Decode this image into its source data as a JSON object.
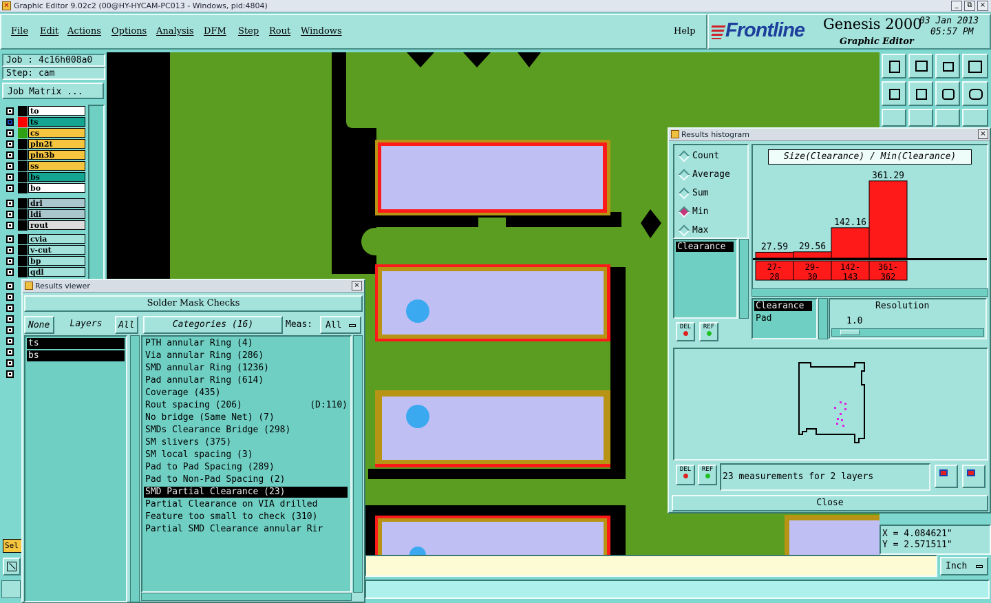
{
  "window": {
    "title": "Graphic Editor 9.02c2 (00@HY-HYCAM-PC013 - Windows, pid:4804)",
    "min": "_",
    "max": "⧉",
    "close": "×"
  },
  "menubar": {
    "items": [
      "File",
      "Edit",
      "Actions",
      "Options",
      "Analysis",
      "DFM",
      "Step",
      "Rout",
      "Windows"
    ],
    "help": "Help"
  },
  "brand": {
    "logo": "Frontline",
    "product": "Genesis 2000",
    "subtitle": "Graphic Editor",
    "date": "03 Jan 2013",
    "time": "05:57 PM"
  },
  "job": {
    "job": "Job : 4c16h008a0",
    "step": "Step: cam",
    "matrix_button": "Job Matrix ..."
  },
  "layers": {
    "group1": [
      {
        "name": "to",
        "color": "#ffffff",
        "swatch": "#000000"
      },
      {
        "name": "ts",
        "color": "#13a592",
        "swatch": "#ff0000",
        "active": true
      },
      {
        "name": "cs",
        "color": "#f6c540",
        "swatch": "#2fa014"
      },
      {
        "name": "pln2t",
        "color": "#f6c540",
        "swatch": "#000000"
      },
      {
        "name": "pln3b",
        "color": "#f6c540",
        "swatch": "#000000"
      },
      {
        "name": "ss",
        "color": "#f6c540",
        "swatch": "#000000"
      },
      {
        "name": "bs",
        "color": "#13a592",
        "swatch": "#000000"
      },
      {
        "name": "bo",
        "color": "#ffffff",
        "swatch": "#000000"
      }
    ],
    "group2": [
      {
        "name": "drl",
        "color": "#a9c6cc",
        "swatch": "#000000"
      },
      {
        "name": "ldi",
        "color": "#a9c6cc",
        "swatch": "#000000"
      },
      {
        "name": "rout",
        "color": "#dcdcdc",
        "swatch": "#000000"
      }
    ],
    "group3": [
      {
        "name": "cvia",
        "color": "#a4e2dc",
        "swatch": "#000000"
      },
      {
        "name": "v-cut",
        "color": "#a4e2dc",
        "swatch": "#000000"
      },
      {
        "name": "bp",
        "color": "#a4e2dc",
        "swatch": "#000000"
      },
      {
        "name": "qdl",
        "color": "#a4e2dc",
        "swatch": "#000000"
      }
    ],
    "sel_label": "Sel"
  },
  "results_viewer": {
    "title": "Results viewer",
    "header": "Solder Mask Checks",
    "none_btn": "None",
    "layers_label": "Layers",
    "all_btn": "All",
    "layer_list": [
      "ts",
      "bs"
    ],
    "categories_label": "Categories (16)",
    "meas_label": "Meas:",
    "meas_value": "All",
    "categories": [
      {
        "text": "PTH annular Ring (4)",
        "extra": ""
      },
      {
        "text": "Via annular Ring (286)",
        "extra": ""
      },
      {
        "text": "SMD annular Ring (1236)",
        "extra": ""
      },
      {
        "text": "Pad annular Ring (614)",
        "extra": ""
      },
      {
        "text": "Coverage (435)",
        "extra": ""
      },
      {
        "text": "Rout spacing (206)",
        "extra": "(D:110)"
      },
      {
        "text": "No bridge (Same Net) (7)",
        "extra": ""
      },
      {
        "text": "SMDs Clearance Bridge (298)",
        "extra": ""
      },
      {
        "text": "SM slivers (375)",
        "extra": ""
      },
      {
        "text": "SM local spacing (3)",
        "extra": ""
      },
      {
        "text": "Pad to Pad Spacing (289)",
        "extra": ""
      },
      {
        "text": "Pad to Non-Pad Spacing (2)",
        "extra": ""
      },
      {
        "text": "SMD Partial Clearance (23)",
        "extra": "",
        "selected": true
      },
      {
        "text": "Partial Clearance on VIA drilled",
        "extra": ""
      },
      {
        "text": "Feature too small to check (310)",
        "extra": ""
      },
      {
        "text": "Partial SMD Clearance annular Rir",
        "extra": ""
      }
    ]
  },
  "histogram": {
    "title": "Results histogram",
    "modes": [
      "Count",
      "Average",
      "Sum",
      "Min",
      "Max"
    ],
    "selected_mode": "Min",
    "measure_list": [
      "Clearance"
    ],
    "del_label": "DEL",
    "ref_label": "REF",
    "chart_title": "Size(Clearance) / Min(Clearance)",
    "bar_color": "#ff1a1a",
    "chart_data": {
      "type": "bar",
      "title": "Size(Clearance) / Min(Clearance)",
      "categories": [
        "27-28",
        "29-30",
        "142-143",
        "361-362"
      ],
      "category_lines": [
        [
          "27-",
          "28"
        ],
        [
          "29-",
          "30"
        ],
        [
          "142-",
          "143"
        ],
        [
          "361-",
          "362"
        ]
      ],
      "values": [
        27.59,
        29.56,
        142.16,
        361.29
      ],
      "value_labels": [
        "27.59",
        "29.56",
        "142.16",
        "361.29"
      ],
      "ylim": [
        0,
        380
      ]
    },
    "filter_list": [
      "Clearance",
      "Pad"
    ],
    "resolution_label": "Resolution",
    "resolution_value": "1.0",
    "status": "23 measurements for 2 layers",
    "close_button": "Close"
  },
  "coords": {
    "x": "X = 4.084621\"",
    "y": "Y = 2.571511\""
  },
  "units": "Inch"
}
